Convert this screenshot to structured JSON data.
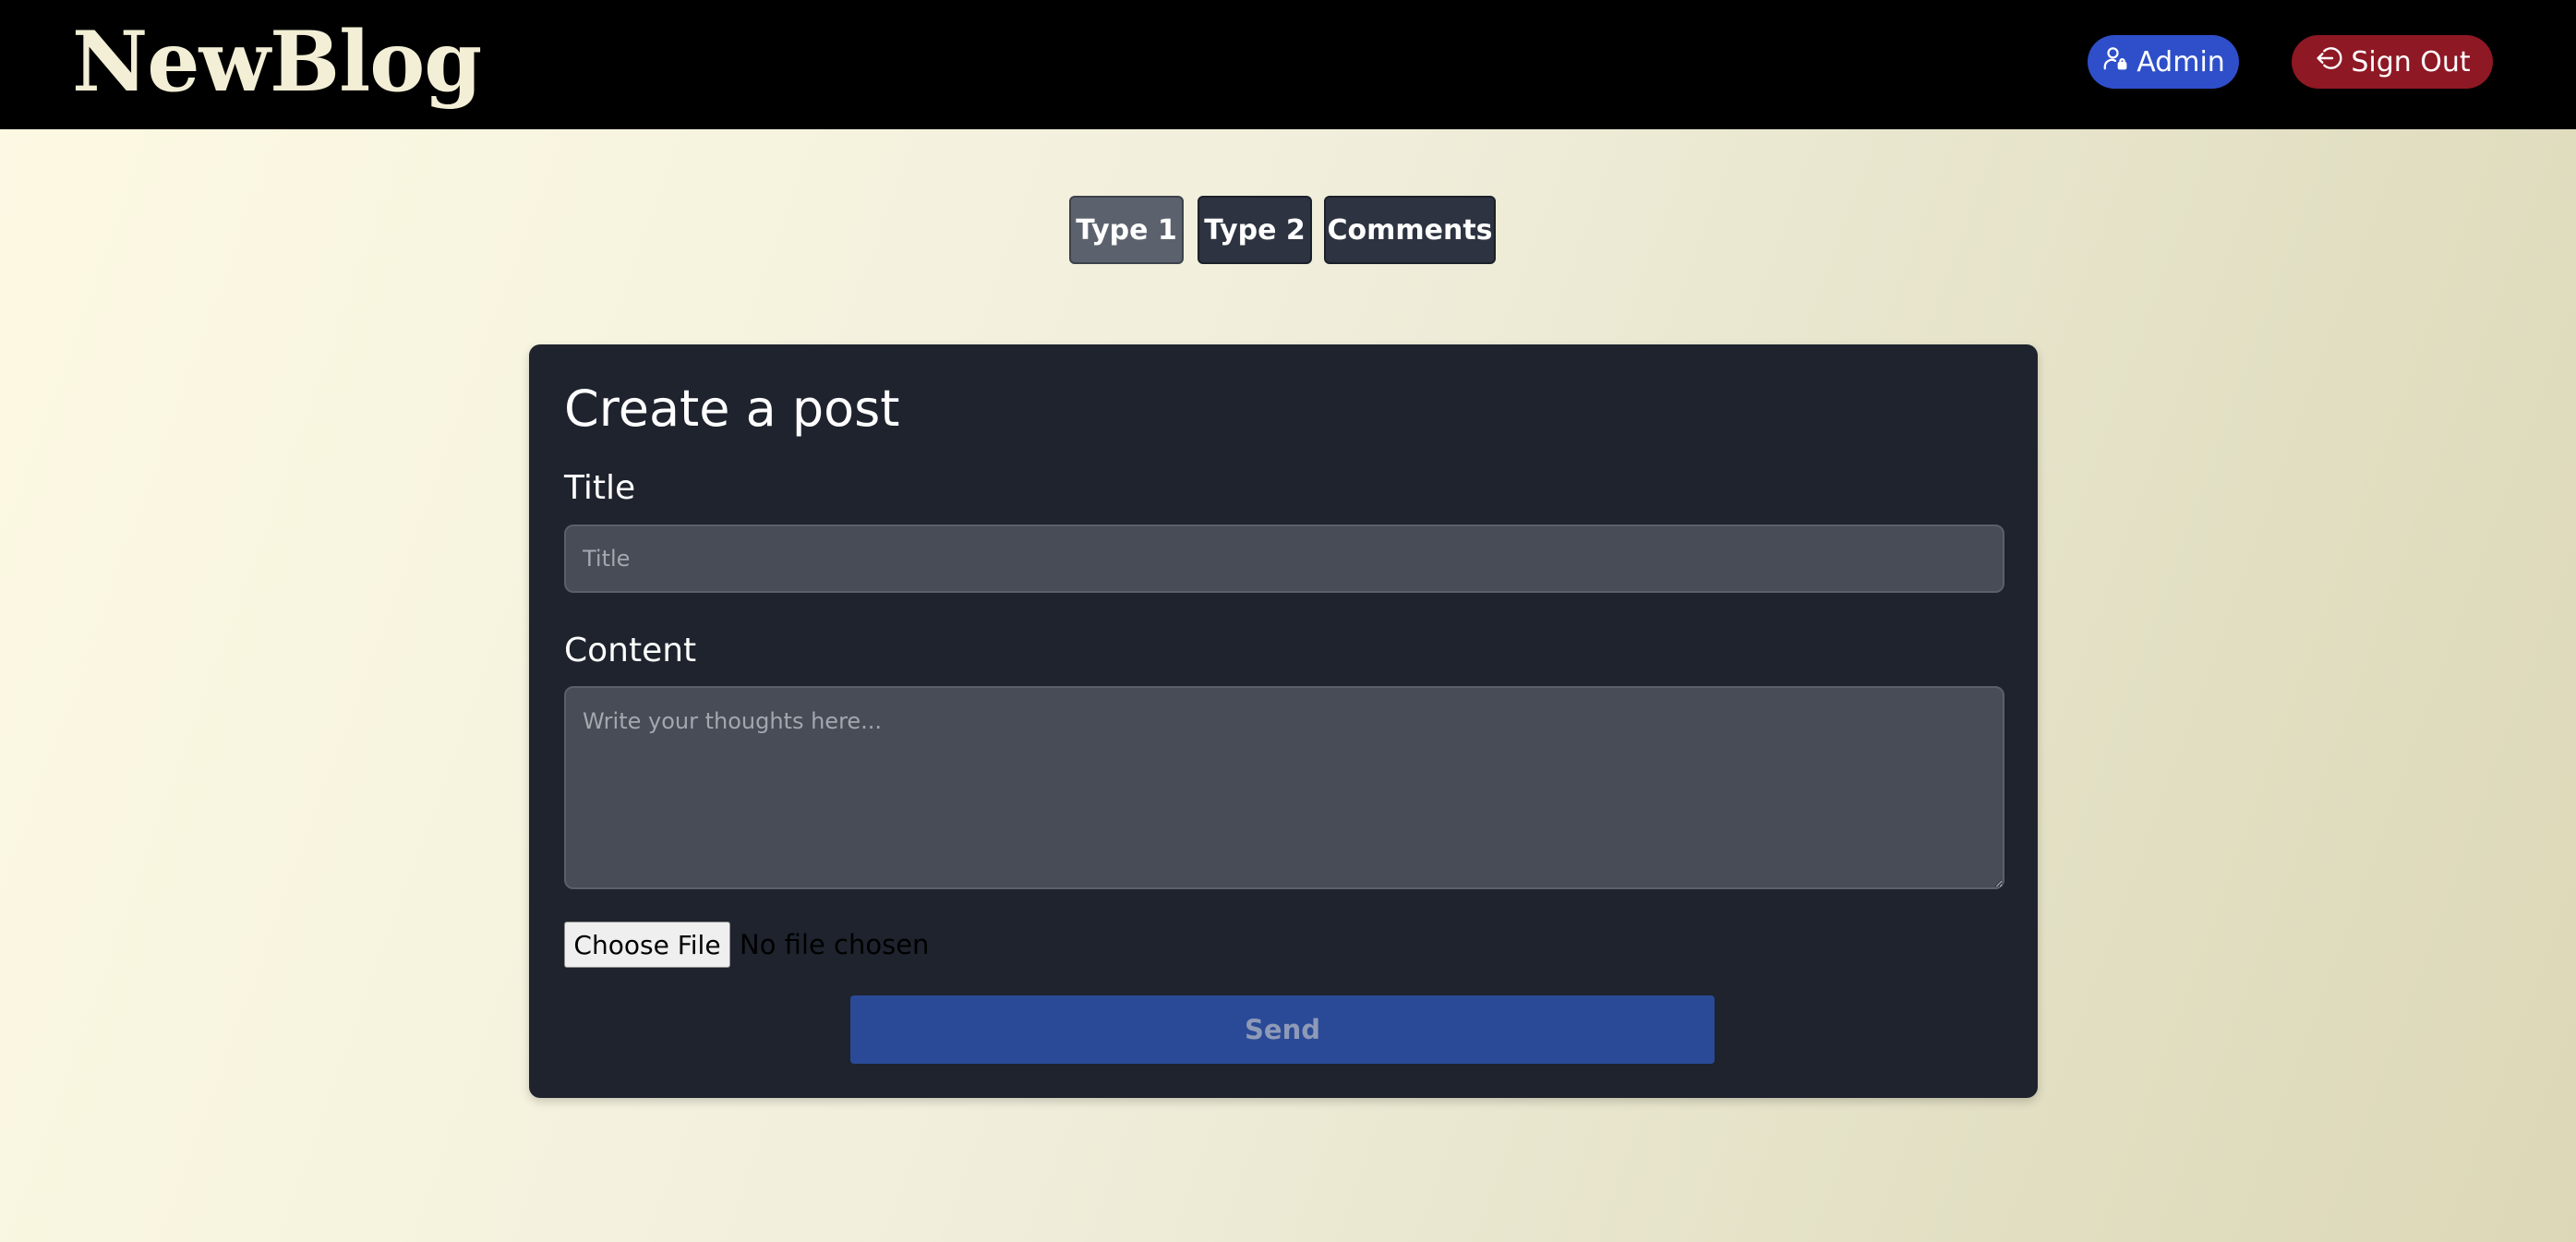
{
  "header": {
    "brand": "NewBlog",
    "admin_label": "Admin",
    "signout_label": "Sign Out",
    "admin_color": "#2e4fc9",
    "signout_color": "#8e1824"
  },
  "tabs": [
    {
      "label": "Type 1",
      "active": true
    },
    {
      "label": "Type 2",
      "active": false
    },
    {
      "label": "Comments",
      "active": false
    }
  ],
  "form": {
    "heading": "Create a post",
    "title_label": "Title",
    "title_placeholder": "Title",
    "title_value": "",
    "content_label": "Content",
    "content_placeholder": "Write your thoughts here...",
    "content_value": "",
    "file_button_label": "Choose File",
    "file_status": "No file chosen",
    "send_label": "Send"
  },
  "icons": {
    "admin": "user-lock-icon",
    "signout": "sign-out-icon"
  }
}
